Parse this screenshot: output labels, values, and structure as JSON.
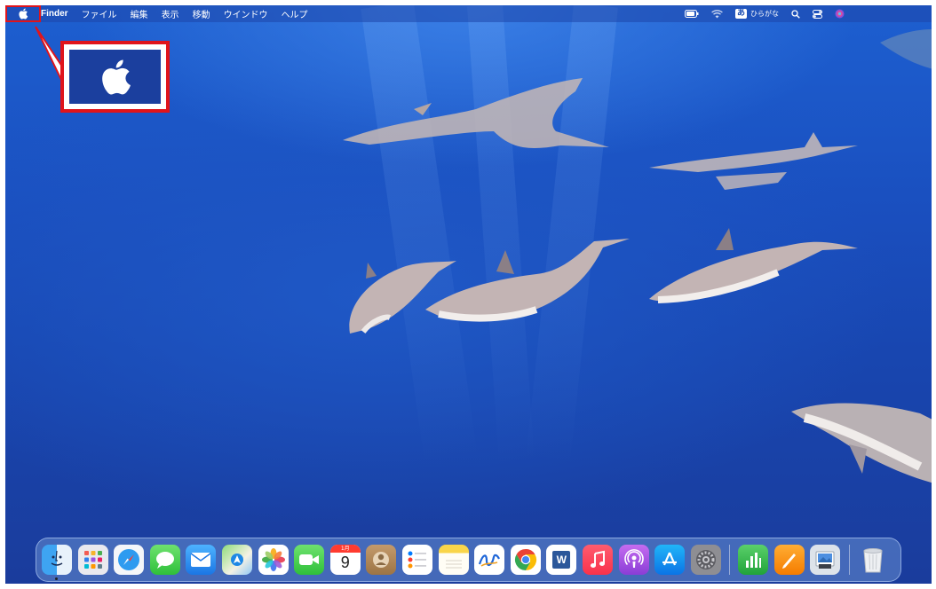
{
  "menubar": {
    "app_name": "Finder",
    "menus": [
      "ファイル",
      "編集",
      "表示",
      "移動",
      "ウインドウ",
      "ヘルプ"
    ],
    "ime_badge": "あ",
    "ime_label": "ひらがな"
  },
  "callout": {
    "icon": "apple-logo-icon"
  },
  "dock": {
    "apps": [
      {
        "name": "Finder",
        "icon": "finder-icon"
      },
      {
        "name": "Launchpad",
        "icon": "launchpad-icon"
      },
      {
        "name": "Safari",
        "icon": "safari-icon"
      },
      {
        "name": "Messages",
        "icon": "messages-icon"
      },
      {
        "name": "Mail",
        "icon": "mail-icon"
      },
      {
        "name": "Maps",
        "icon": "maps-icon"
      },
      {
        "name": "Photos",
        "icon": "photos-icon"
      },
      {
        "name": "FaceTime",
        "icon": "facetime-icon"
      },
      {
        "name": "Calendar",
        "icon": "calendar-icon"
      },
      {
        "name": "Contacts",
        "icon": "contacts-icon"
      },
      {
        "name": "Reminders",
        "icon": "reminders-icon"
      },
      {
        "name": "Notes",
        "icon": "notes-icon"
      },
      {
        "name": "Freeform",
        "icon": "freeform-icon"
      },
      {
        "name": "Chrome",
        "icon": "chrome-icon"
      },
      {
        "name": "Word",
        "icon": "word-icon"
      },
      {
        "name": "Music",
        "icon": "music-icon"
      },
      {
        "name": "Podcasts",
        "icon": "podcasts-icon"
      },
      {
        "name": "App Store",
        "icon": "app-store-icon"
      },
      {
        "name": "System Settings",
        "icon": "system-settings-icon"
      },
      {
        "name": "Numbers",
        "icon": "numbers-icon"
      },
      {
        "name": "Pages",
        "icon": "pages-icon"
      },
      {
        "name": "Preview",
        "icon": "preview-icon"
      },
      {
        "name": "Trash",
        "icon": "trash-icon"
      }
    ],
    "calendar_month": "1月",
    "calendar_day": "9",
    "word_letter": "W"
  }
}
